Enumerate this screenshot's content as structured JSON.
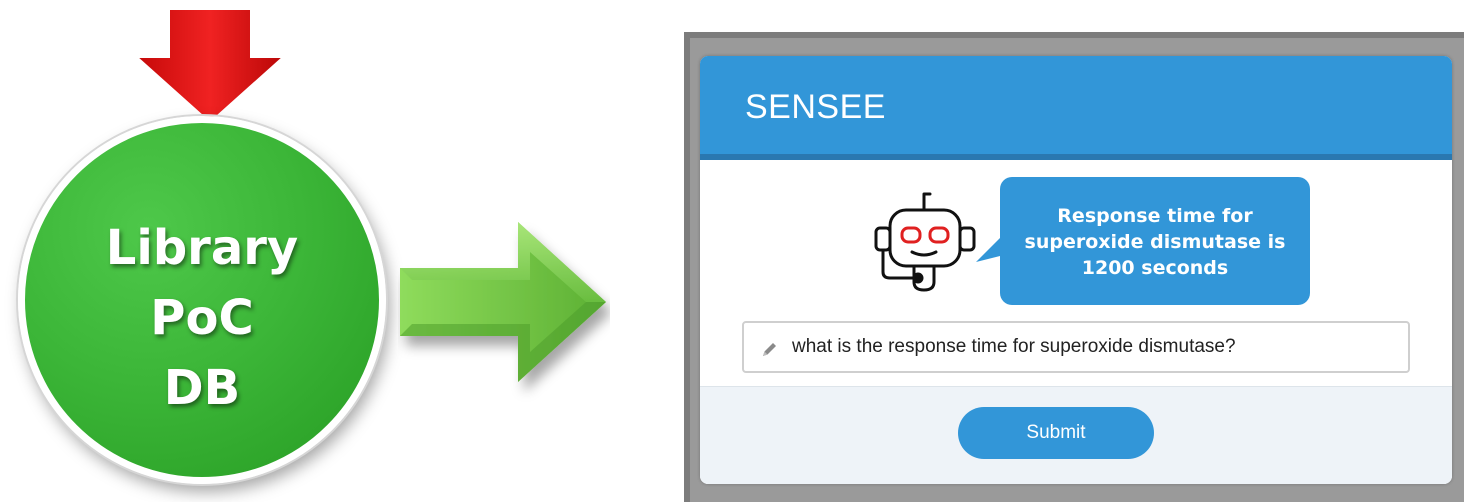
{
  "diagram": {
    "db_label": [
      "Library",
      "PoC",
      "DB"
    ],
    "colors": {
      "down_arrow": "#e31010",
      "db_circle": "#3cb638",
      "right_arrow": "#78c84a"
    }
  },
  "app": {
    "title": "SENSEE",
    "bot_response": [
      "Response time for",
      "superoxide dismutase is",
      "1200 seconds"
    ],
    "query": {
      "value": "what is the response time for superoxide dismutase?"
    },
    "submit_label": "Submit",
    "colors": {
      "accent": "#3296d8",
      "robot_eyes": "#e02020"
    },
    "icons": [
      "robot-headset-icon",
      "pencil-icon"
    ]
  }
}
